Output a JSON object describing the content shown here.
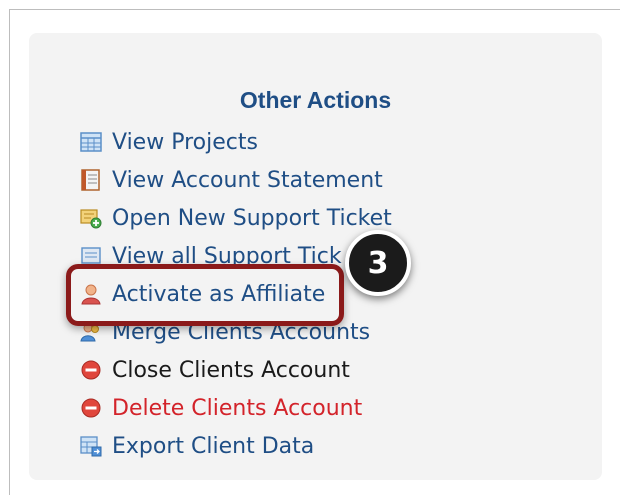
{
  "panel": {
    "title": "Other Actions"
  },
  "actions": [
    {
      "label": "View Projects",
      "icon": "table-icon"
    },
    {
      "label": "View Account Statement",
      "icon": "ledger-icon"
    },
    {
      "label": "Open New Support Ticket",
      "icon": "ticket-add-icon"
    },
    {
      "label": "View all Support Tick",
      "icon": "ticket-list-icon"
    },
    {
      "label": "Activate as Affiliate",
      "icon": "user-icon"
    },
    {
      "label": "Merge Clients Accounts",
      "icon": "users-merge-icon"
    },
    {
      "label": "Close Clients Account",
      "icon": "minus-circle-icon"
    },
    {
      "label": "Delete Clients Account",
      "icon": "minus-circle-icon"
    },
    {
      "label": "Export Client Data",
      "icon": "export-icon"
    }
  ],
  "callout": {
    "number": "3"
  }
}
